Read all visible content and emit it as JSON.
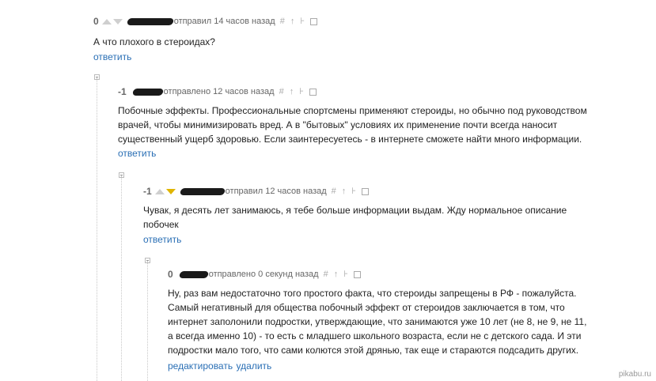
{
  "comments": [
    {
      "rating": "0",
      "time": "отправил 14 часов назад",
      "text": "А что плохого в стероидах?",
      "action": "ответить"
    },
    {
      "rating": "-1",
      "time": "отправлено 12 часов назад",
      "text_lines": [
        "Побочные эффекты. Профессиональные спортсмены применяют стероиды, но обычно под руководством",
        "врачей, чтобы минимизировать вред. А в \"бытовых\" условиях их применение почти всегда наносит",
        "существенный ущерб здоровью. Если заинтересуетесь - в интернете сможете найти много информации."
      ],
      "action": "ответить"
    },
    {
      "rating": "-1",
      "time": "отправил 12 часов назад",
      "text_lines": [
        "Чувак, я десять лет занимаюсь, я тебе больше информации выдам. Жду нормальное описание",
        "побочек"
      ],
      "action": "ответить"
    },
    {
      "rating": "0",
      "time": "отправлено 0 секунд назад",
      "text_lines": [
        "Ну, раз вам недостаточно того простого факта, что стероиды запрещены в РФ - пожалуйста.",
        "Самый негативный для общества побочный эффект от стероидов заключается в том, что",
        "интернет заполонили подростки, утверждающие, что занимаются уже 10 лет (не 8, не 9, не 11,",
        "а всегда именно 10) - то есть с младшего школьного возраста, если не с детского сада. И эти",
        "подростки мало того, что сами колются этой дрянью, так еще и стараются подсадить других."
      ],
      "action_edit": "редактировать",
      "action_delete": "удалить"
    }
  ],
  "icons": [
    "hash-icon",
    "up-arrow-icon",
    "tree-icon",
    "save-icon"
  ],
  "watermark": "pikabu.ru"
}
